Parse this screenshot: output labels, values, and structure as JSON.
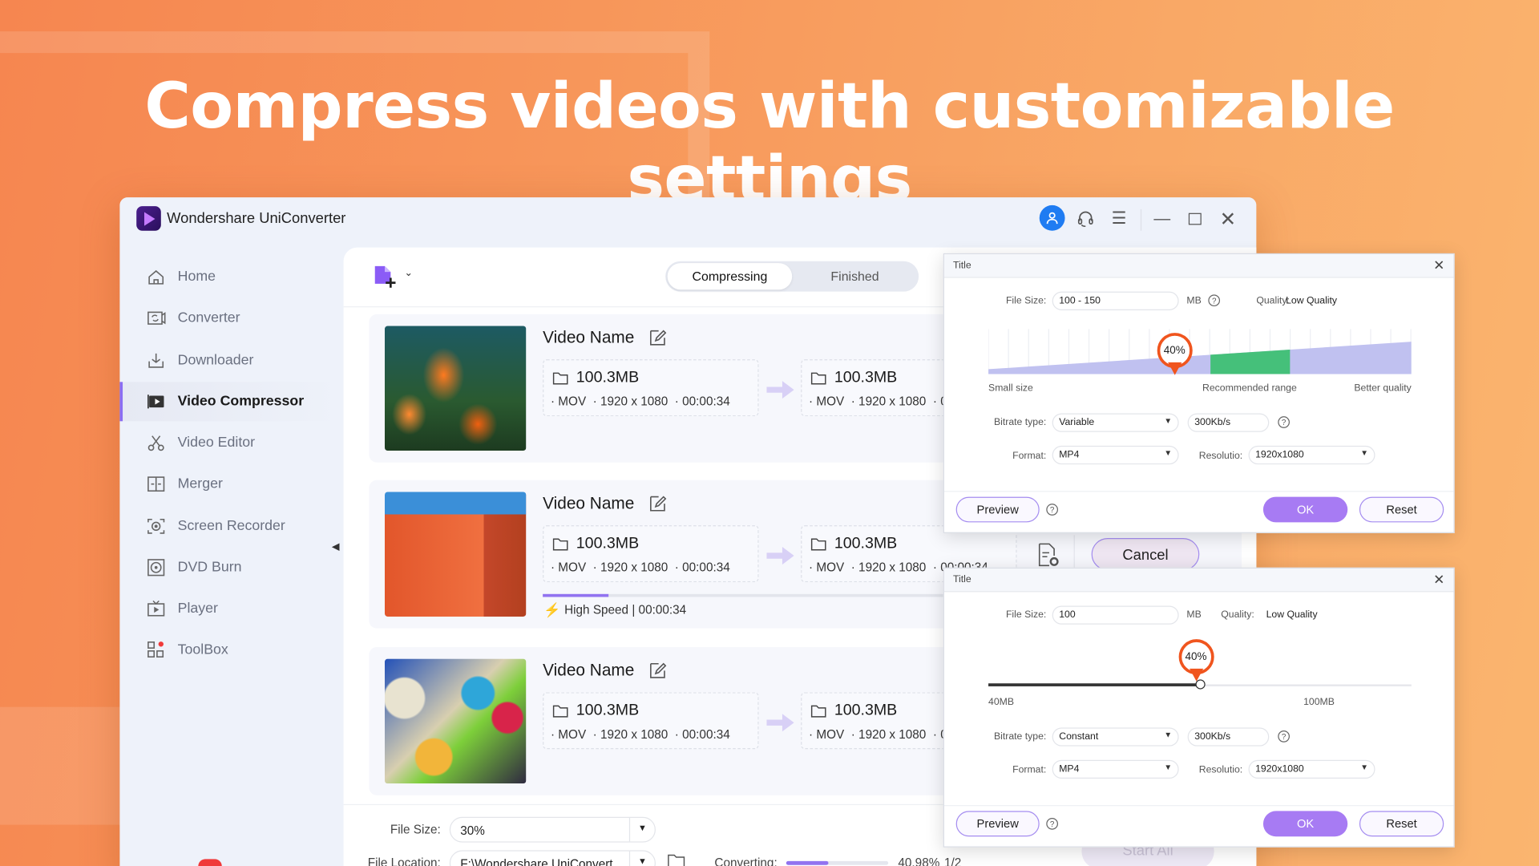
{
  "headline": "Compress videos with customizable settings",
  "app": {
    "title": "Wondershare UniConverter"
  },
  "window_controls": [
    "user-icon",
    "headset-icon",
    "menu-icon",
    "minimize-icon",
    "maximize-icon",
    "close-icon"
  ],
  "sidebar": {
    "items": [
      {
        "label": "Home",
        "icon": "home-icon"
      },
      {
        "label": "Converter",
        "icon": "converter-icon"
      },
      {
        "label": "Downloader",
        "icon": "download-icon"
      },
      {
        "label": "Video Compressor",
        "icon": "video-compressor-icon",
        "active": true
      },
      {
        "label": "Video Editor",
        "icon": "scissors-icon"
      },
      {
        "label": "Merger",
        "icon": "merge-icon"
      },
      {
        "label": "Screen Recorder",
        "icon": "screen-record-icon"
      },
      {
        "label": "DVD Burn",
        "icon": "disc-icon"
      },
      {
        "label": "Player",
        "icon": "player-icon"
      },
      {
        "label": "ToolBox",
        "icon": "toolbox-icon",
        "badge_dot": true
      }
    ]
  },
  "tabs": [
    {
      "label": "Compressing",
      "active": true
    },
    {
      "label": "Finished"
    }
  ],
  "rows": [
    {
      "name": "Video Name",
      "src": {
        "size": "100.3MB",
        "format": "· MOV",
        "res": "· 1920 x 1080",
        "dur": "· 00:00:34"
      },
      "dst": {
        "size": "100.3MB",
        "format": "· MOV",
        "res": "· 1920 x 1080",
        "dur": "· 0"
      }
    },
    {
      "name": "Video Name",
      "src": {
        "size": "100.3MB",
        "format": "· MOV",
        "res": "· 1920 x 1080",
        "dur": "· 00:00:34"
      },
      "dst": {
        "size": "100.3MB",
        "format": "· MOV",
        "res": "· 1920 x 1080",
        "dur": "· 00:00:34"
      },
      "progress": 0.16,
      "status": "High Speed | 00:00:34",
      "cancel_label": "Cancel"
    },
    {
      "name": "Video Name",
      "src": {
        "size": "100.3MB",
        "format": "· MOV",
        "res": "· 1920 x 1080",
        "dur": "· 00:00:34"
      },
      "dst": {
        "size": "100.3MB",
        "format": "· MOV",
        "res": "· 1920 x 1080",
        "dur": "· 0"
      }
    }
  ],
  "bottom": {
    "file_size_label": "File Size:",
    "file_size_value": "30%",
    "file_location_label": "File Location:",
    "file_location_value": "F:\\Wondershare UniConvert",
    "converting_label": "Converting:",
    "converting_progress": 0.4098,
    "converting_percent": "40.98%",
    "converting_count": "1/2",
    "start_all": "Start All"
  },
  "dialog1": {
    "title": "Title",
    "file_size_label": "File Size:",
    "file_size": "100 - 150",
    "unit": "MB",
    "quality_label": "Quality:",
    "quality": "Low Quality",
    "marker": "40%",
    "marker_value": 0.44,
    "recommended_range": [
      0.525,
      0.713
    ],
    "scale_labels": [
      "Small size",
      "Recommended range",
      "Better quality"
    ],
    "bitrate_label": "Bitrate type:",
    "bitrate": "Variable",
    "bitrate_value": "300Kb/s",
    "format_label": "Format:",
    "format": "MP4",
    "resolution_label": "Resolutio:",
    "resolution": "1920x1080",
    "preview": "Preview",
    "ok": "OK",
    "reset": "Reset"
  },
  "dialog2": {
    "title": "Title",
    "file_size_label": "File Size:",
    "file_size": "100",
    "unit": "MB",
    "quality_label": "Quality:",
    "quality": "Low Quality",
    "marker": "40%",
    "slider_value": 0.5,
    "min_label": "40MB",
    "max_label": "100MB",
    "bitrate_label": "Bitrate type:",
    "bitrate": "Constant",
    "bitrate_value": "300Kb/s",
    "format_label": "Format:",
    "format": "MP4",
    "resolution_label": "Resolutio:",
    "resolution": "1920x1080",
    "preview": "Preview",
    "ok": "OK",
    "reset": "Reset"
  },
  "colors": {
    "accent": "#a77bf3",
    "marker": "#f0551e",
    "recommended": "#45c07a",
    "range": "#c0c1f0",
    "user": "#1f7cf2"
  }
}
